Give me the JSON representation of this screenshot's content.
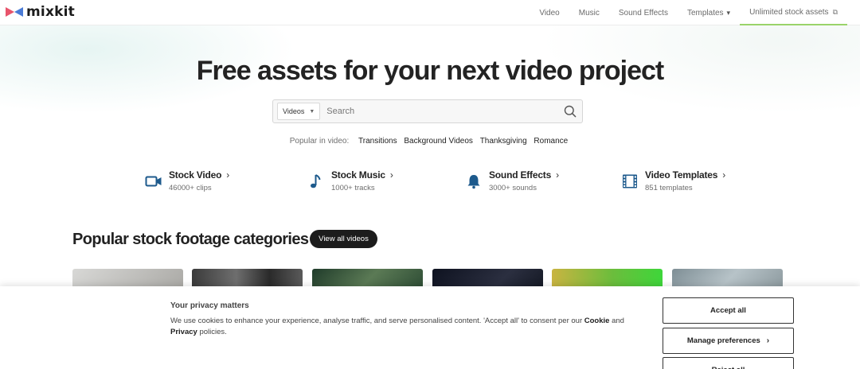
{
  "header": {
    "logo_text": "mixkit",
    "nav": [
      {
        "label": "Video"
      },
      {
        "label": "Music"
      },
      {
        "label": "Sound Effects"
      },
      {
        "label": "Templates"
      },
      {
        "label": "Unlimited stock assets"
      }
    ]
  },
  "hero": {
    "title": "Free assets for your next video project",
    "search": {
      "type_label": "Videos",
      "placeholder": "Search"
    },
    "popular_label": "Popular in video:",
    "popular_tags": [
      "Transitions",
      "Background Videos",
      "Thanksgiving",
      "Romance"
    ]
  },
  "categories": [
    {
      "title": "Stock Video",
      "sub": "46000+ clips",
      "icon": "video-camera-icon"
    },
    {
      "title": "Stock Music",
      "sub": "1000+ tracks",
      "icon": "music-note-icon"
    },
    {
      "title": "Sound Effects",
      "sub": "3000+ sounds",
      "icon": "bell-icon"
    },
    {
      "title": "Video Templates",
      "sub": "851 templates",
      "icon": "film-icon"
    }
  ],
  "section": {
    "title": "Popular stock footage categories",
    "view_all_label": "View all videos"
  },
  "cookie": {
    "heading": "Your privacy matters",
    "text_pre": "We use cookies to enhance your experience, analyse traffic, and serve personalised content. 'Accept all' to consent per our ",
    "cookie_link": "Cookie",
    "text_and": " and ",
    "privacy_link": "Privacy",
    "text_post": " policies.",
    "accept_label": "Accept all",
    "manage_label": "Manage preferences",
    "reject_label": "Reject all"
  },
  "colors": {
    "accent_green": "#9ad36a",
    "icon_blue": "#1d5a8c",
    "dark": "#1c1c1c"
  }
}
